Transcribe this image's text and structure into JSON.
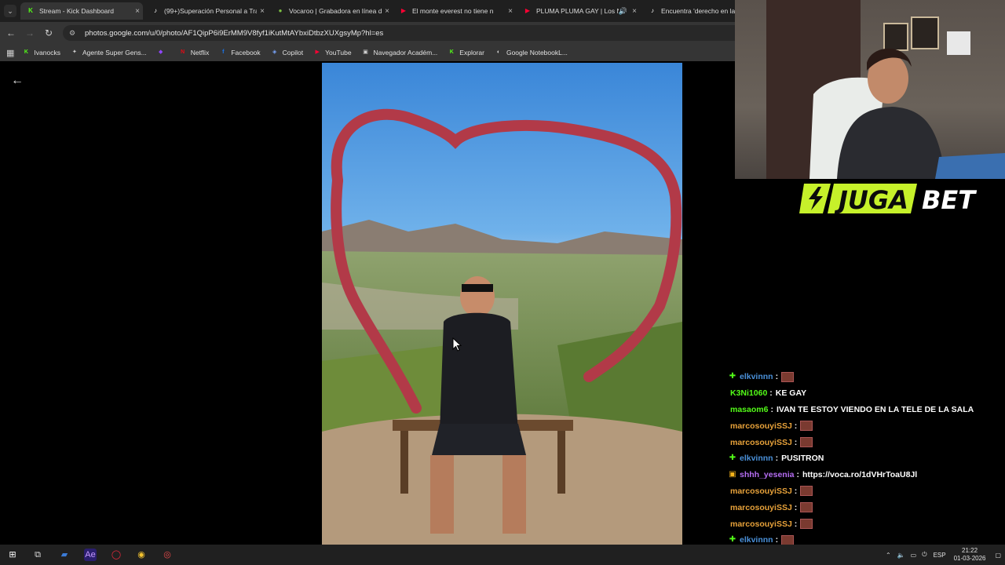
{
  "browser": {
    "tabs": [
      {
        "title": "Stream - Kick Dashboard",
        "favicon": "kick-icon",
        "color": "#53fc18",
        "active": true
      },
      {
        "title": "(99+)Superación Personal a Tra",
        "favicon": "tiktok-icon",
        "color": "#ffffff",
        "active": false
      },
      {
        "title": "Vocaroo | Grabadora en línea d",
        "favicon": "vocaroo-icon",
        "color": "#7cc242",
        "active": false
      },
      {
        "title": "El monte everest no tiene n",
        "favicon": "youtube-icon",
        "color": "#ff0033",
        "active": false
      },
      {
        "title": "PLUMA PLUMA GAY | Los N",
        "favicon": "youtube-icon",
        "color": "#ff0033",
        "active": false
      },
      {
        "title": "Encuentra 'derecho en la ca",
        "favicon": "tiktok-icon",
        "color": "#ffffff",
        "active": false
      }
    ],
    "url": "photos.google.com/u/0/photo/AF1QipP6i9ErMM9V8fyf1iKutMtAYbxiDtbzXUXgsyMp?hl=es",
    "bookmarks": [
      {
        "label": "Ivanocks",
        "icon": "kick-icon",
        "color": "#53fc18"
      },
      {
        "label": "Agente Super Gens...",
        "icon": "gemini-icon",
        "color": "#cfcfcf"
      },
      {
        "label": "",
        "icon": "twitch-icon",
        "color": "#9146ff"
      },
      {
        "label": "Netflix",
        "icon": "netflix-icon",
        "color": "#e50914"
      },
      {
        "label": "Facebook",
        "icon": "facebook-icon",
        "color": "#1877f2"
      },
      {
        "label": "Copilot",
        "icon": "copilot-icon",
        "color": "#7aa7ff"
      },
      {
        "label": "YouTube",
        "icon": "youtube-icon",
        "color": "#ff0033"
      },
      {
        "label": "Navegador Académ...",
        "icon": "folder-icon",
        "color": "#cfcfcf"
      },
      {
        "label": "Explorar",
        "icon": "kick-icon",
        "color": "#53fc18"
      },
      {
        "label": "Google NotebookL...",
        "icon": "notebooklm-icon",
        "color": "#dddddd"
      }
    ]
  },
  "overlay": {
    "sponsor_left": "JUGA",
    "sponsor_right": "BET"
  },
  "chat": {
    "messages": [
      {
        "user": "elkvinnn",
        "color": "#4a90d9",
        "badge": "gem",
        "text": "",
        "emote": true
      },
      {
        "user": "K3Ni1060",
        "color": "#53fc18",
        "badge": "",
        "text": "KE GAY",
        "emote": false
      },
      {
        "user": "masaom6",
        "color": "#53fc18",
        "badge": "",
        "text": "IVAN TE ESTOY VIENDO EN LA TELE DE LA SALA",
        "emote": false
      },
      {
        "user": "marcosouyiSSJ",
        "color": "#e8a23a",
        "badge": "",
        "text": "",
        "emote": true
      },
      {
        "user": "marcosouyiSSJ",
        "color": "#e8a23a",
        "badge": "",
        "text": "",
        "emote": true
      },
      {
        "user": "elkvinnn",
        "color": "#4a90d9",
        "badge": "gem",
        "text": "PUSITRON",
        "emote": false
      },
      {
        "user": "shhh_yesenia",
        "color": "#b56df2",
        "badge": "sub",
        "text": "https://voca.ro/1dVHrToaU8Jl",
        "emote": false
      },
      {
        "user": "marcosouyiSSJ",
        "color": "#e8a23a",
        "badge": "",
        "text": "",
        "emote": true
      },
      {
        "user": "marcosouyiSSJ",
        "color": "#e8a23a",
        "badge": "",
        "text": "",
        "emote": true
      },
      {
        "user": "marcosouyiSSJ",
        "color": "#e8a23a",
        "badge": "",
        "text": "",
        "emote": true
      },
      {
        "user": "elkvinnn",
        "color": "#4a90d9",
        "badge": "gem",
        "text": "",
        "emote": true
      },
      {
        "user": "elkvinnn",
        "color": "#4a90d9",
        "badge": "gem",
        "text": "",
        "emote": true
      }
    ]
  },
  "taskbar": {
    "language": "ESP",
    "time": "21:22",
    "date": "01-03-2026"
  }
}
